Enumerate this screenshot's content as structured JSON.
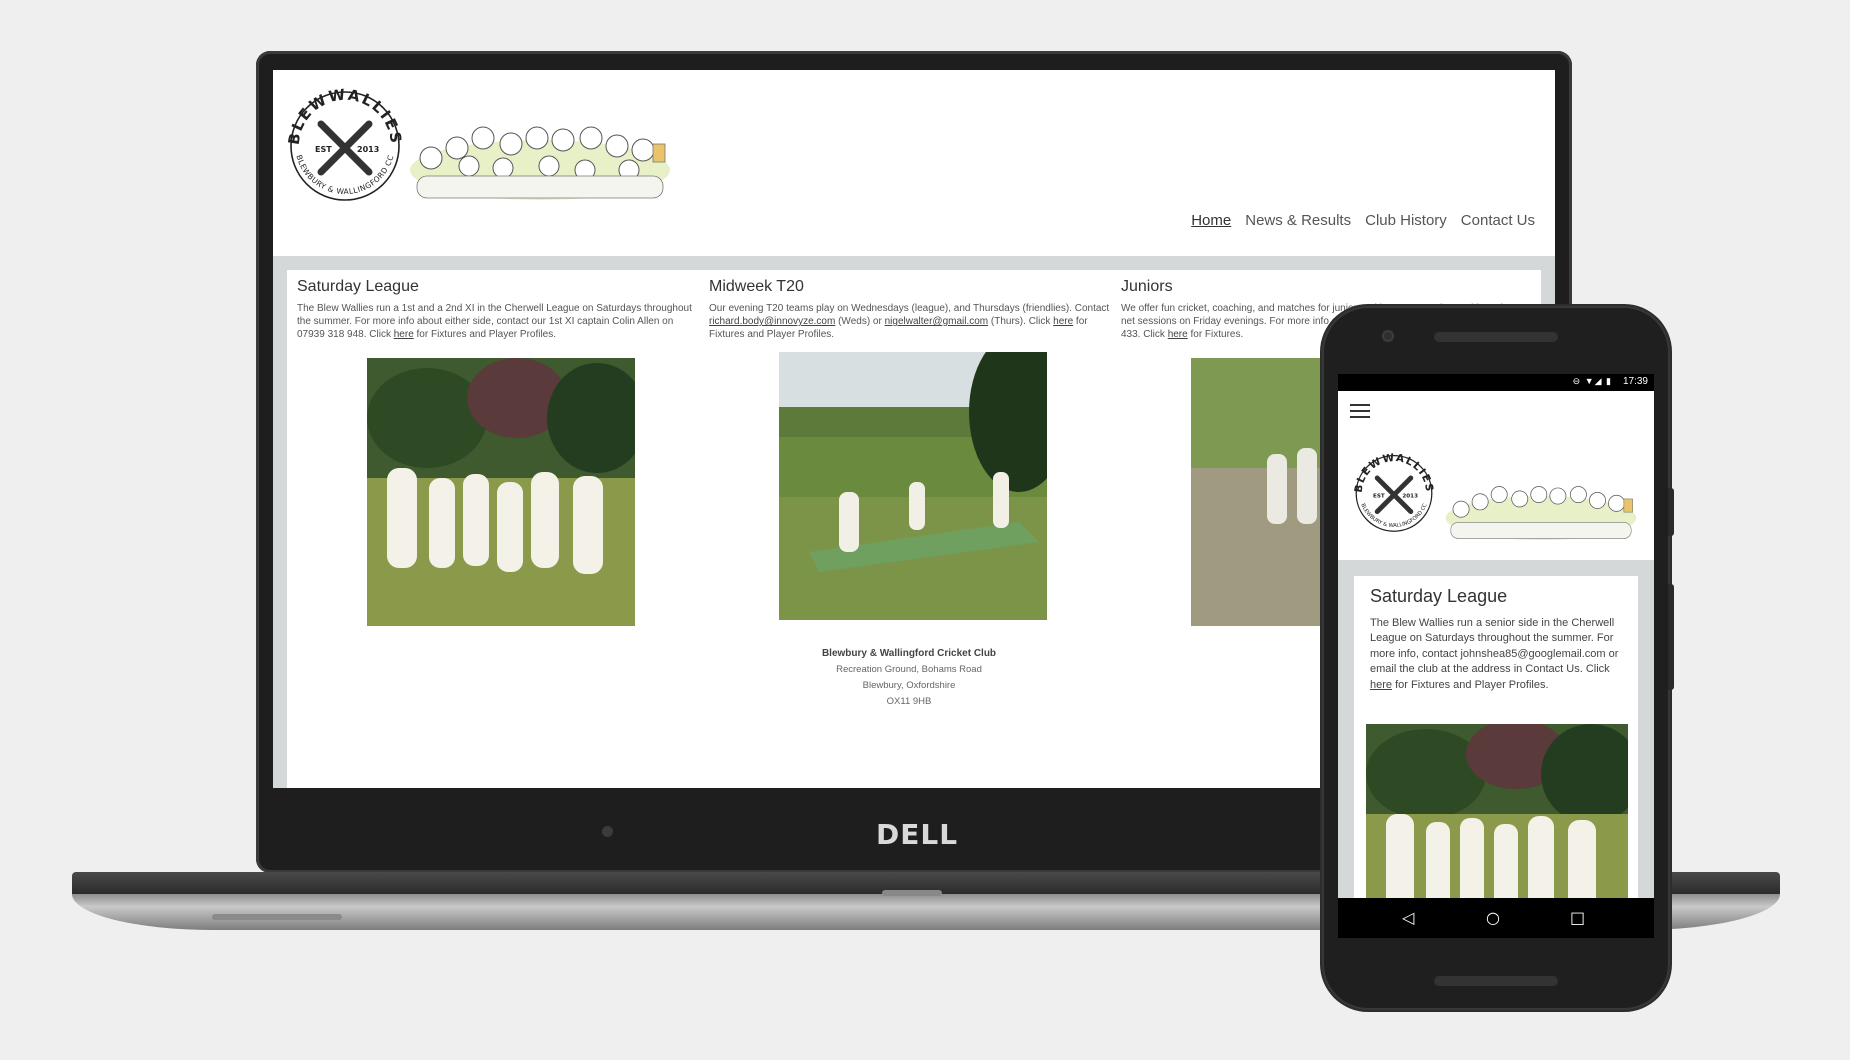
{
  "desktop": {
    "nav": [
      "Home",
      "News & Results",
      "Club History",
      "Contact Us"
    ],
    "columns": [
      {
        "title": "Saturday League",
        "text_before": "The Blew Wallies run a 1st and a 2nd XI in the Cherwell League on Saturdays throughout the summer. For more info about either side, contact our 1st XI captain Colin Allen on 07939 318 948. Click ",
        "link": "here",
        "text_after": " for Fixtures and Player Profiles."
      },
      {
        "title": "Midweek T20",
        "text_before": "Our evening T20 teams play on Wednesdays (league), and Thursdays (friendlies). Contact ",
        "email1": "richard.body@innovyze.com",
        "mid1": " (Weds) or ",
        "email2": "nigelwalter@gmail.com",
        "mid2": " (Thurs). Click ",
        "link": "here",
        "text_after": " for Fixtures and Player Profiles."
      },
      {
        "title": "Juniors",
        "text_before": "We offer fun cricket, coaching, and matches for juniors, with our U11 and U15 sides, plus net sessions on Friday evenings. For more info contact our junior organiser on 07900 123 433. Click ",
        "link": "here",
        "text_after": " for Fixtures."
      }
    ],
    "footer": {
      "name": "Blewbury & Wallingford Cricket Club",
      "line1": "Recreation Ground, Bohams Road",
      "line2": "Blewbury, Oxfordshire",
      "line3": "OX11 9HB"
    },
    "brand": "DELL"
  },
  "logo": {
    "top": "BLEWWALLIES",
    "est": "EST",
    "year": "2013",
    "bottom": "BLEWBURY & WALLINGFORD CC"
  },
  "mobile": {
    "time": "17:39",
    "title": "Saturday League",
    "text_before": "The Blew Wallies run a senior side in the Cherwell League on Saturdays throughout the summer. For more info, contact johnshea85@googlemail.com or email the club at the address in Contact Us. Click ",
    "link": "here",
    "text_after": " for Fixtures and Player Profiles."
  }
}
